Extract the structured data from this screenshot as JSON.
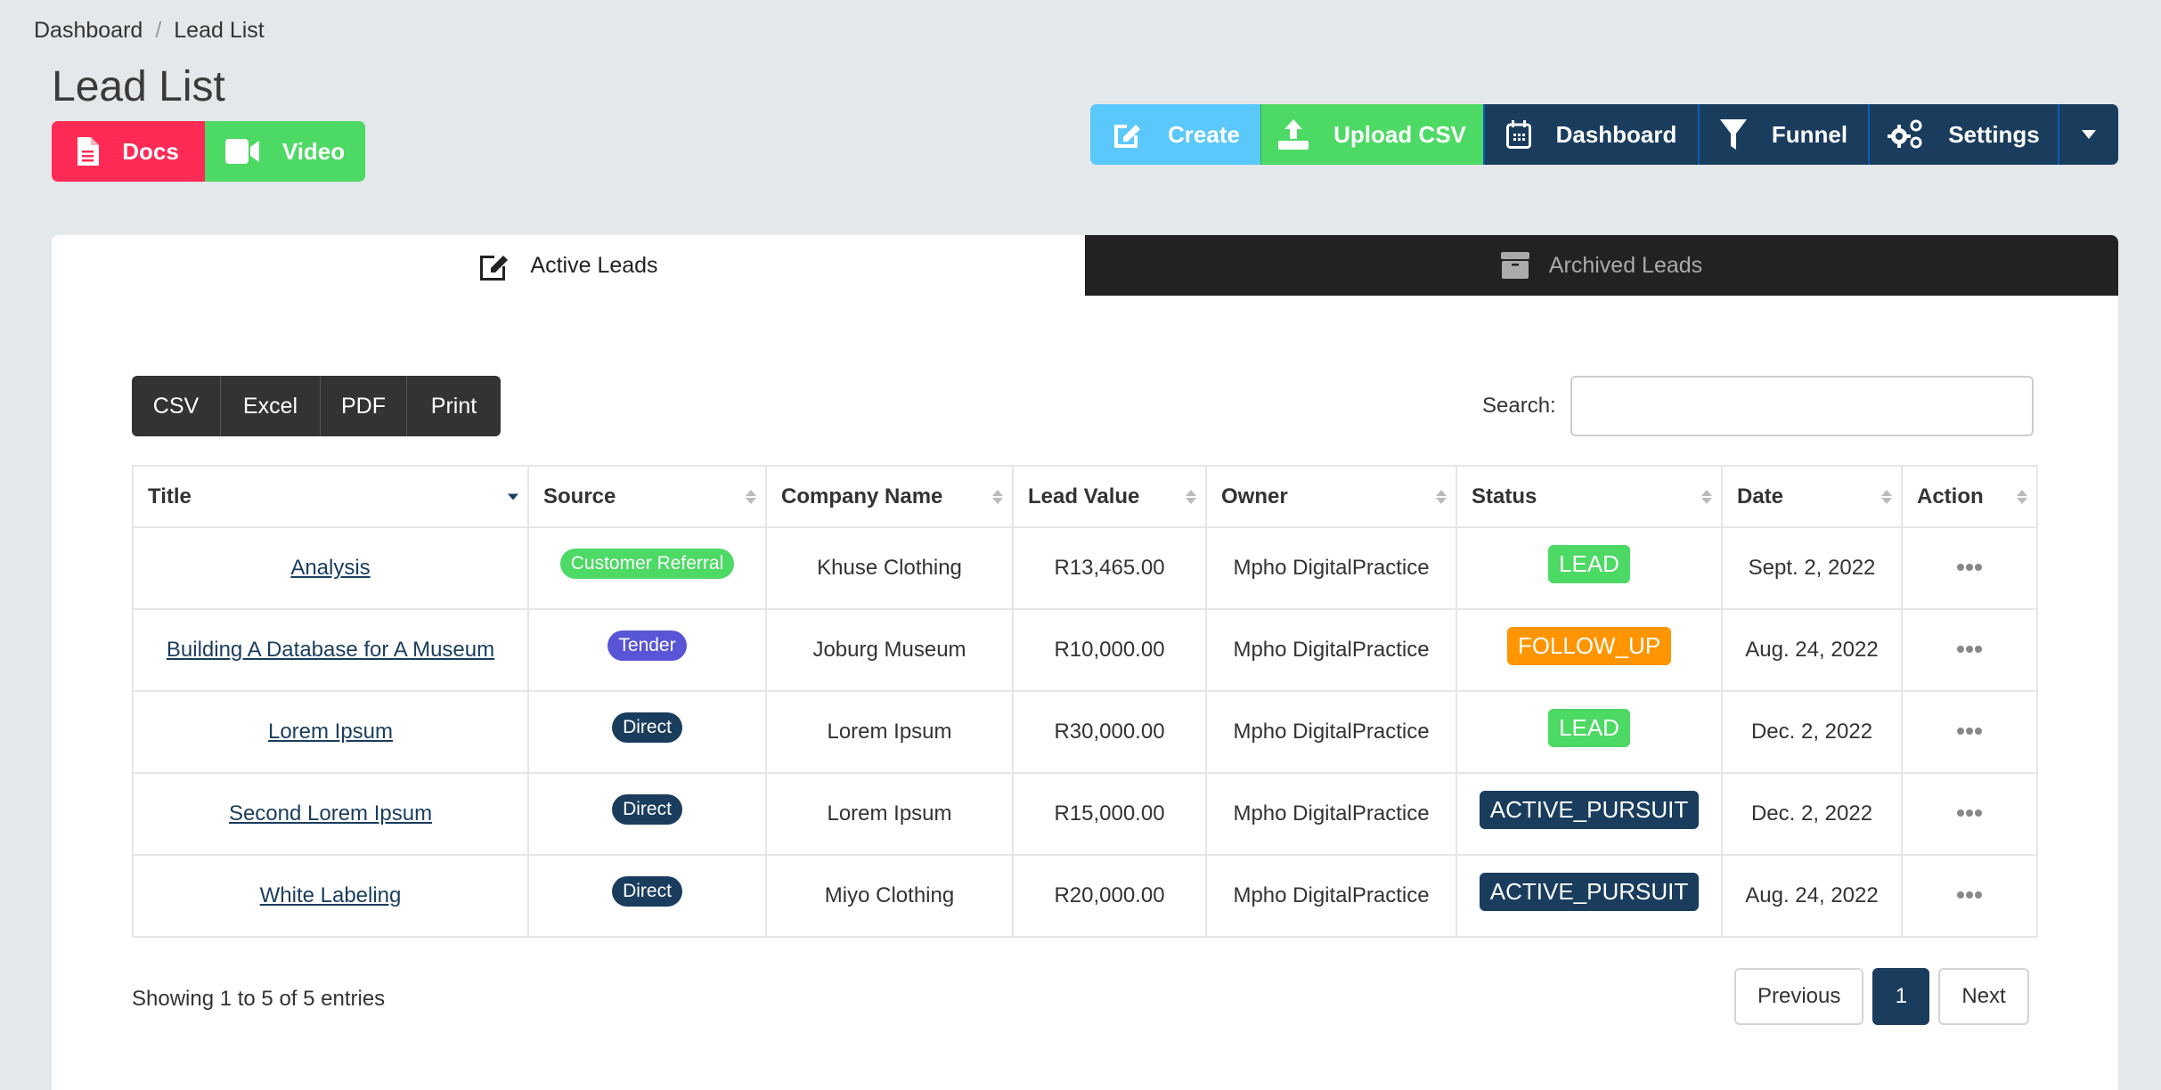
{
  "breadcrumb": {
    "items": [
      "Dashboard",
      "Lead List"
    ],
    "separator": "/"
  },
  "page": {
    "title": "Lead List"
  },
  "help_buttons": {
    "docs": "Docs",
    "video": "Video"
  },
  "actions": {
    "create": "Create",
    "upload_csv": "Upload CSV",
    "dashboard": "Dashboard",
    "funnel": "Funnel",
    "settings": "Settings"
  },
  "tabs": {
    "active": "Active Leads",
    "archived": "Archived Leads"
  },
  "export": {
    "csv": "CSV",
    "excel": "Excel",
    "pdf": "PDF",
    "print": "Print"
  },
  "search": {
    "label": "Search:",
    "value": "",
    "placeholder": ""
  },
  "table": {
    "columns": [
      "Title",
      "Source",
      "Company Name",
      "Lead Value",
      "Owner",
      "Status",
      "Date",
      "Action"
    ],
    "sorted_column": "Title",
    "rows": [
      {
        "title": "Analysis",
        "source": "Customer Referral",
        "company": "Khuse Clothing",
        "value": "R13,465.00",
        "owner": "Mpho DigitalPractice",
        "status": "LEAD",
        "date": "Sept. 2, 2022"
      },
      {
        "title": "Building A Database for A Museum",
        "source": "Tender",
        "company": "Joburg Museum",
        "value": "R10,000.00",
        "owner": "Mpho DigitalPractice",
        "status": "FOLLOW_UP",
        "date": "Aug. 24, 2022"
      },
      {
        "title": "Lorem Ipsum",
        "source": "Direct",
        "company": "Lorem Ipsum",
        "value": "R30,000.00",
        "owner": "Mpho DigitalPractice",
        "status": "LEAD",
        "date": "Dec. 2, 2022"
      },
      {
        "title": "Second Lorem Ipsum",
        "source": "Direct",
        "company": "Lorem Ipsum",
        "value": "R15,000.00",
        "owner": "Mpho DigitalPractice",
        "status": "ACTIVE_PURSUIT",
        "date": "Dec. 2, 2022"
      },
      {
        "title": "White Labeling",
        "source": "Direct",
        "company": "Miyo Clothing",
        "value": "R20,000.00",
        "owner": "Mpho DigitalPractice",
        "status": "ACTIVE_PURSUIT",
        "date": "Aug. 24, 2022"
      }
    ]
  },
  "source_colors": {
    "Customer Referral": "#4cd964",
    "Tender": "#5856d6",
    "Direct": "#1a3d5e"
  },
  "status_colors": {
    "LEAD": "#4cd964",
    "FOLLOW_UP": "#ff9500",
    "ACTIVE_PURSUIT": "#1a3d5e"
  },
  "footer": {
    "info": "Showing 1 to 5 of 5 entries",
    "previous": "Previous",
    "current_page": "1",
    "next": "Next"
  }
}
